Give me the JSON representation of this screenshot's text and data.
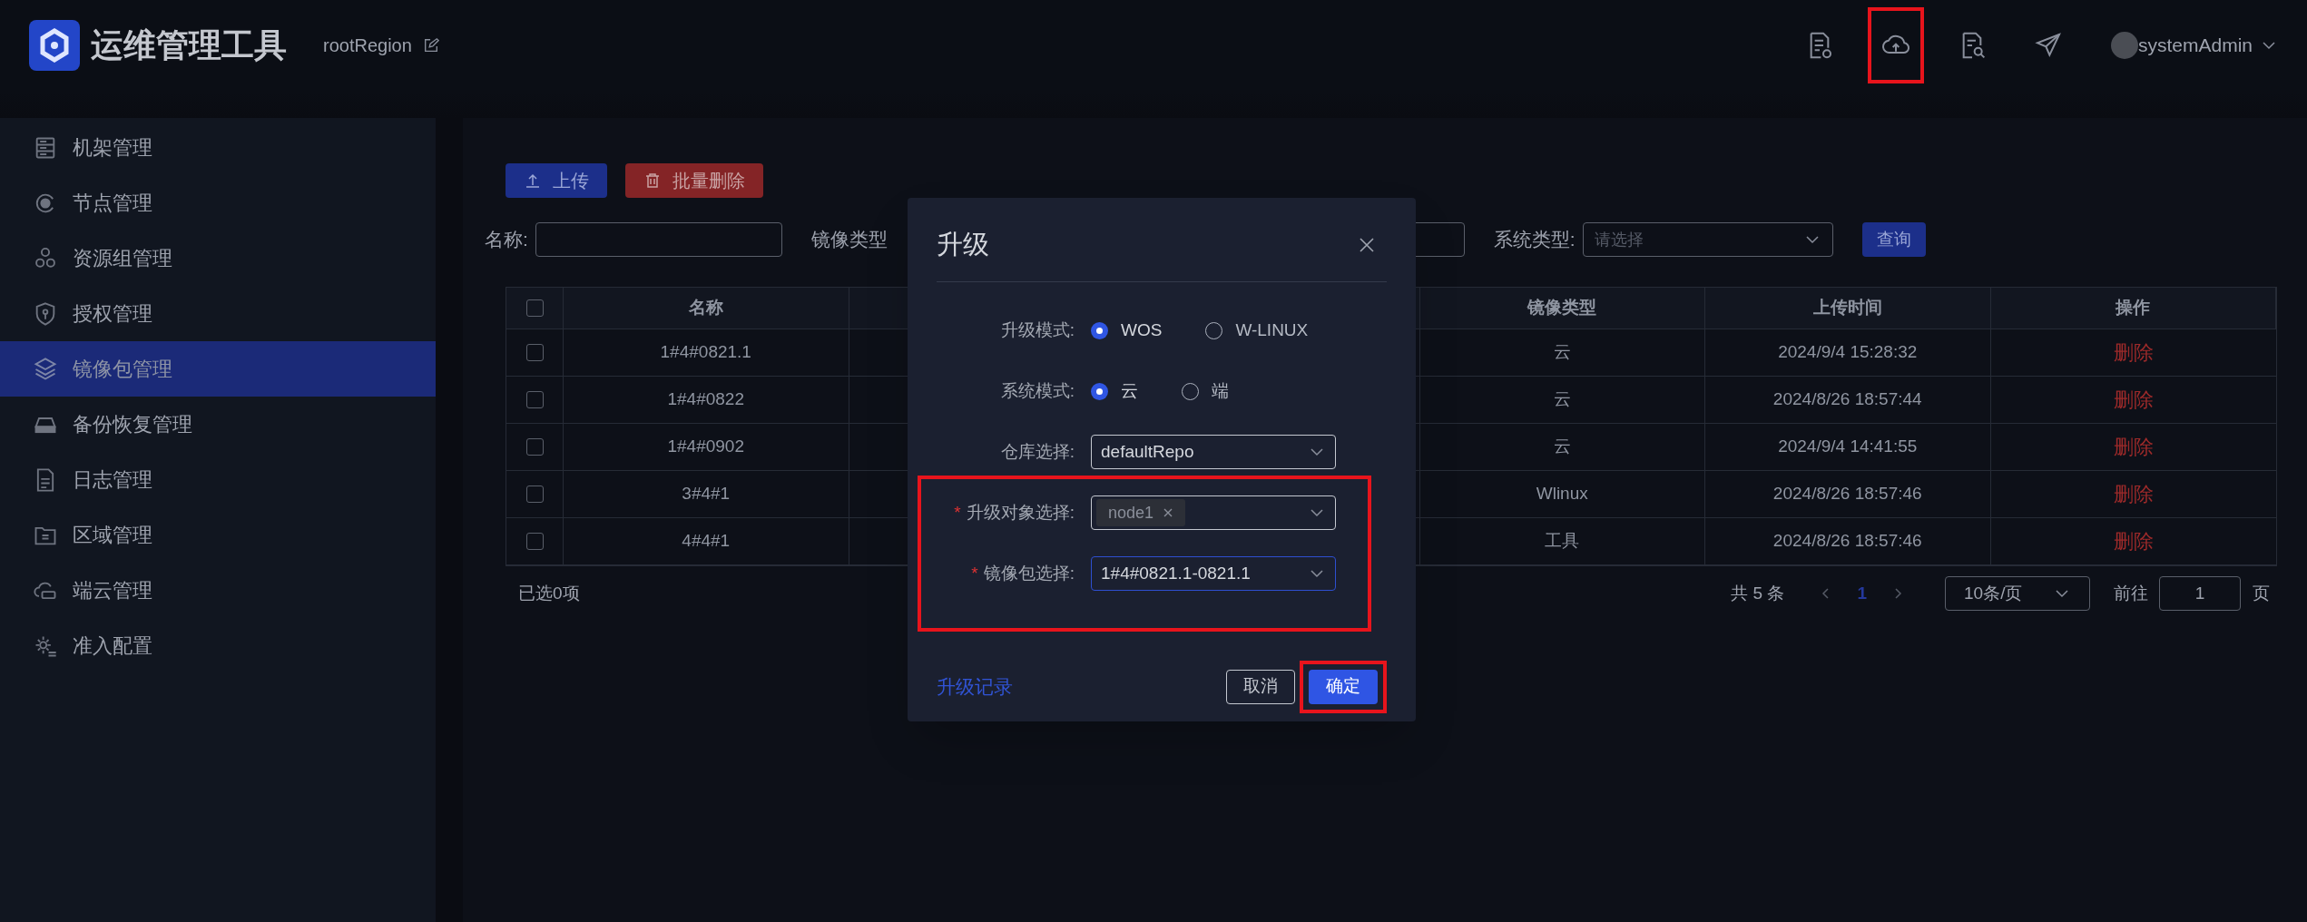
{
  "header": {
    "app_title": "运维管理工具",
    "region": "rootRegion",
    "user": "systemAdmin",
    "actions": [
      {
        "kind": "doc-gear",
        "highlighted": false
      },
      {
        "kind": "cloud-upload",
        "highlighted": true
      },
      {
        "kind": "doc-search",
        "highlighted": false
      },
      {
        "kind": "send",
        "highlighted": false
      }
    ]
  },
  "sidebar": {
    "items": [
      {
        "label": "机架管理",
        "selected": false
      },
      {
        "label": "节点管理",
        "selected": false
      },
      {
        "label": "资源组管理",
        "selected": false
      },
      {
        "label": "授权管理",
        "selected": false
      },
      {
        "label": "镜像包管理",
        "selected": true
      },
      {
        "label": "备份恢复管理",
        "selected": false
      },
      {
        "label": "日志管理",
        "selected": false
      },
      {
        "label": "区域管理",
        "selected": false
      },
      {
        "label": "端云管理",
        "selected": false
      },
      {
        "label": "准入配置",
        "selected": false
      }
    ]
  },
  "toolbar": {
    "buttons": [
      {
        "label": "上传",
        "kind": "primary"
      },
      {
        "label": "批量删除",
        "kind": "danger"
      }
    ]
  },
  "filters": {
    "name_label": "名称:",
    "type_label": "镜像类型",
    "system_label": "系统类型:",
    "system_placeholder": "请选择",
    "query": "查询"
  },
  "table": {
    "all_checked": false,
    "columns": [
      "名称",
      "镜像类型",
      "上传时间",
      "操作"
    ],
    "rows": [
      {
        "name": "1#4#0821.1",
        "image_type": "云",
        "upload_time": "2024/9/4 15:28:32",
        "action": "删除",
        "checked": false
      },
      {
        "name": "1#4#0822",
        "image_type": "云",
        "upload_time": "2024/8/26 18:57:44",
        "action": "删除",
        "checked": false
      },
      {
        "name": "1#4#0902",
        "image_type": "云",
        "upload_time": "2024/9/4 14:41:55",
        "action": "删除",
        "checked": false
      },
      {
        "name": "3#4#1",
        "image_type": "Wlinux",
        "upload_time": "2024/8/26 18:57:46",
        "action": "删除",
        "checked": false
      },
      {
        "name": "4#4#1",
        "image_type": "工具",
        "upload_time": "2024/8/26 18:57:46",
        "action": "删除",
        "checked": false
      }
    ],
    "selected_count": "已选0项"
  },
  "pagination": {
    "total": "共 5 条",
    "current": "1",
    "page_size": "10条/页",
    "goto_label": "前往",
    "goto_value": "1",
    "page_suffix": "页"
  },
  "dialog": {
    "title": "升级",
    "fields": [
      {
        "kind": "radio",
        "label": "升级模式:",
        "highlighted": false,
        "options": [
          {
            "label": "WOS",
            "selected": true
          },
          {
            "label": "W-LINUX",
            "selected": false
          }
        ]
      },
      {
        "kind": "radio",
        "label": "系统模式:",
        "highlighted": false,
        "options": [
          {
            "label": "云",
            "selected": true
          },
          {
            "label": "端",
            "selected": false
          }
        ]
      },
      {
        "kind": "select",
        "label": "仓库选择:",
        "highlighted": false,
        "value": "defaultRepo",
        "focused": false
      },
      {
        "kind": "tags",
        "label": "升级对象选择:",
        "required_mark": "*",
        "highlighted": true,
        "tags": [
          "node1"
        ]
      },
      {
        "kind": "select",
        "label": "镜像包选择:",
        "required_mark": "*",
        "highlighted": true,
        "value": "1#4#0821.1-0821.1",
        "focused": true
      }
    ],
    "link": "升级记录",
    "cancel": "取消",
    "confirm": "确定",
    "confirm_highlighted": true
  }
}
